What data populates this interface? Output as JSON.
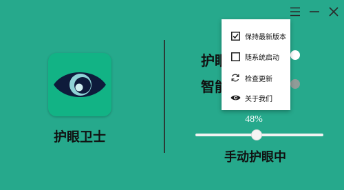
{
  "app": {
    "name": "护眼卫士"
  },
  "window": {
    "controls": [
      "menu-icon",
      "minimize-icon",
      "close-icon"
    ]
  },
  "settings": [
    {
      "label": "护眼模式",
      "visible_text": "护眼",
      "on": true
    },
    {
      "label": "智能模式",
      "visible_text": "智能",
      "on": false
    }
  ],
  "brightness": {
    "percent_text": "48%",
    "value": 0.48
  },
  "status": "手动护眼中",
  "menu": {
    "items": [
      {
        "label": "保持最新版本",
        "icon": "checkbox-checked-icon"
      },
      {
        "label": "随系统启动",
        "icon": "checkbox-unchecked-icon"
      },
      {
        "label": "检查更新",
        "icon": "refresh-icon"
      },
      {
        "label": "关于我们",
        "icon": "eye-icon"
      }
    ]
  },
  "colors": {
    "background": "#26a98c",
    "icon_tile": "#12b385",
    "eye_dark": "#0e1b3b",
    "toggle_on": "#ffffff",
    "toggle_off": "#8f9c98"
  }
}
